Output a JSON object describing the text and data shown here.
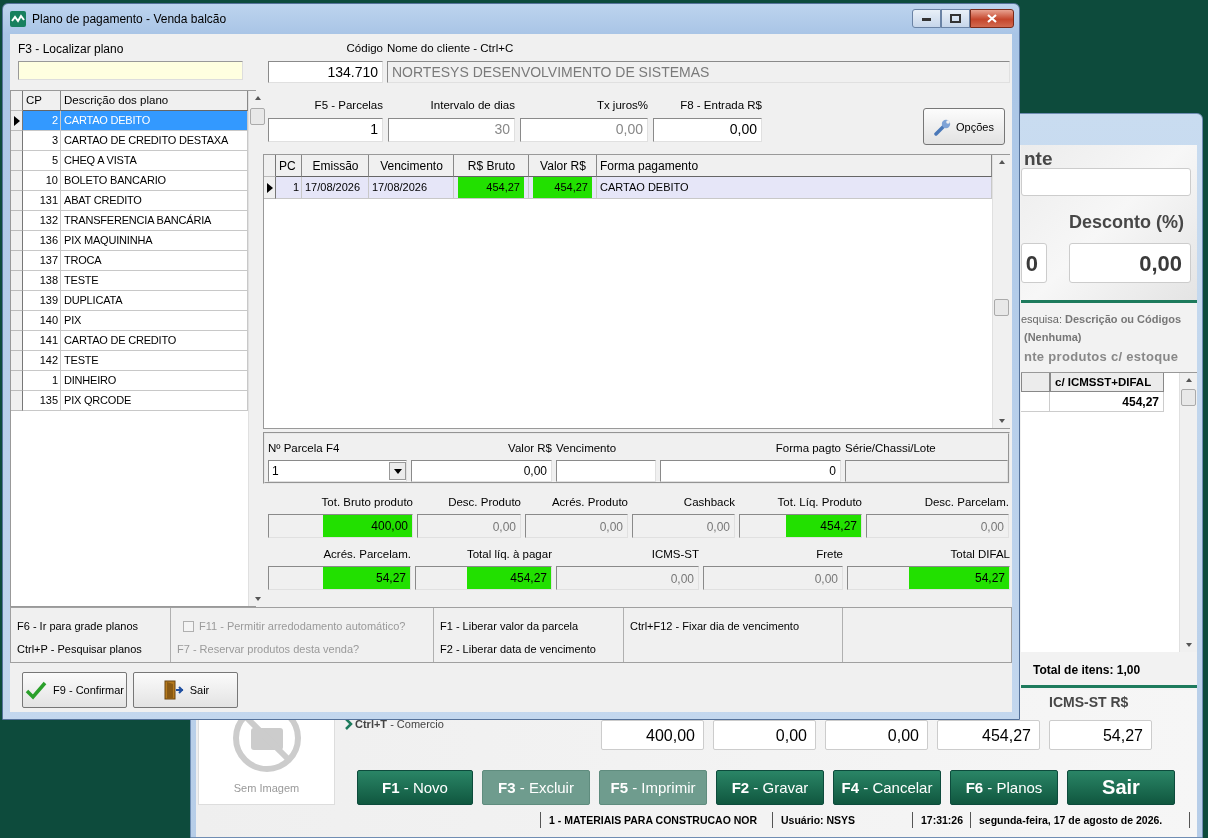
{
  "desktop_window": {
    "right_panel": {
      "heading": "nte",
      "field_value": "0",
      "discount_label": "Desconto (%)",
      "discount_value": "0,00",
      "search_label": "esquisa:",
      "search_value": "Descrição ou Códigos",
      "filter": "(Nenhuma)",
      "stock_filter": "nte produtos c/ estoque",
      "grid_column": "c/ ICMSST+DIFAL",
      "grid_value": "454,27",
      "total_items": "Total de itens: 1,00"
    },
    "no_image_label": "Sem Imagem",
    "shortcut_hint": "**Ctrl+T** - Comercio",
    "totals_label": "ICMS-ST R$",
    "totals": [
      "400,00",
      "0,00",
      "0,00",
      "454,27",
      "54,27"
    ],
    "buttons": [
      {
        "label": "**F1** - Novo",
        "kind": "normal",
        "disabled": false
      },
      {
        "label": "**F3** - Excluir",
        "kind": "normal",
        "disabled": true
      },
      {
        "label": "**F5** - Imprimir",
        "kind": "normal",
        "disabled": true
      },
      {
        "label": "**F2** - Gravar",
        "kind": "normal",
        "disabled": false
      },
      {
        "label": "**F4** - Cancelar",
        "kind": "normal",
        "disabled": false
      },
      {
        "label": "**F6** - Planos",
        "kind": "normal",
        "disabled": false
      },
      {
        "label": "Sair",
        "kind": "exit",
        "disabled": false
      }
    ],
    "status_bar": [
      "1 - MATERIAIS PARA CONSTRUCAO NOR",
      "Usuário: NSYS",
      "17:31:26",
      "segunda-feira, 17 de agosto de 2026."
    ]
  },
  "dialog": {
    "title": "Plano de pagamento - Venda balcão",
    "plan_search": {
      "label": "F3 - Localizar plano"
    },
    "plans": {
      "columns": [
        "CP",
        "Descrição dos plano"
      ],
      "rows": [
        {
          "code": "2",
          "description": "CARTAO DEBITO",
          "selected": true
        },
        {
          "code": "3",
          "description": "CARTAO DE CREDITO DESTAXA",
          "selected": false
        },
        {
          "code": "5",
          "description": "CHEQ A VISTA",
          "selected": false
        },
        {
          "code": "10",
          "description": "BOLETO BANCARIO",
          "selected": false
        },
        {
          "code": "131",
          "description": "ABAT CREDITO",
          "selected": false
        },
        {
          "code": "132",
          "description": "TRANSFERENCIA BANCÁRIA",
          "selected": false
        },
        {
          "code": "136",
          "description": "PIX MAQUININHA",
          "selected": false
        },
        {
          "code": "137",
          "description": "TROCA",
          "selected": false
        },
        {
          "code": "138",
          "description": "TESTE",
          "selected": false
        },
        {
          "code": "139",
          "description": "DUPLICATA",
          "selected": false
        },
        {
          "code": "140",
          "description": "PIX",
          "selected": false
        },
        {
          "code": "141",
          "description": "CARTAO DE CREDITO",
          "selected": false
        },
        {
          "code": "142",
          "description": "TESTE",
          "selected": false
        },
        {
          "code": "1",
          "description": "DINHEIRO",
          "selected": false
        },
        {
          "code": "135",
          "description": "PIX QRCODE",
          "selected": false
        }
      ]
    },
    "header_fields": [
      [
        {
          "label": "Código",
          "value": "134.710",
          "kind": "number",
          "disabled": false
        },
        {
          "label": "Nome do cliente - Ctrl+C",
          "value": "NORTESYS DESENVOLVIMENTO DE SISTEMAS",
          "kind": "text",
          "disabled": true
        }
      ],
      [
        {
          "label": "F5 - Parcelas",
          "value": "1",
          "kind": "number",
          "disabled": false
        },
        {
          "label": "Intervalo de dias",
          "value": "30",
          "kind": "number",
          "disabled": true
        },
        {
          "label": "Tx juros%",
          "value": "0,00",
          "kind": "number",
          "disabled": true
        },
        {
          "label": "F8 - Entrada R$",
          "value": "0,00",
          "kind": "number",
          "disabled": false
        }
      ]
    ],
    "options_button": "Opções",
    "installments": {
      "columns": [
        "PC",
        "Emissão",
        "Vencimento",
        "R$ Bruto",
        "Valor R$",
        "Forma pagamento"
      ],
      "rows": [
        {
          "selected": true,
          "cells": [
            {
              "text": "1",
              "highlighted": false
            },
            {
              "text": "17/08/2026",
              "highlighted": false
            },
            {
              "text": "17/08/2026",
              "highlighted": false
            },
            {
              "text": "454,27",
              "highlighted": true
            },
            {
              "text": "454,27",
              "highlighted": true
            },
            {
              "text": "CARTAO DEBITO",
              "highlighted": false
            }
          ]
        }
      ]
    },
    "installment_editor": [
      {
        "label": "Nº Parcela F4",
        "value": "1",
        "kind": "combo"
      },
      {
        "label": "Valor R$",
        "value": "0,00",
        "kind": "number"
      },
      {
        "label": "Vencimento",
        "kind": "text"
      },
      {
        "label": "Forma pagto",
        "value": "0",
        "kind": "number"
      },
      {
        "label": "Série/Chassi/Lote",
        "kind": "disabled"
      }
    ],
    "totals": [
      [
        {
          "label": "Tot. Bruto produto",
          "value": "400,00",
          "highlighted": true
        },
        {
          "label": "Desc. Produto",
          "value": "0,00",
          "highlighted": false
        },
        {
          "label": "Acrés. Produto",
          "value": "0,00",
          "highlighted": false
        },
        {
          "label": "Cashback",
          "value": "0,00",
          "highlighted": false
        },
        {
          "label": "Tot. Líq. Produto",
          "value": "454,27",
          "highlighted": true
        },
        {
          "label": "Desc. Parcelam.",
          "value": "0,00",
          "highlighted": false
        }
      ],
      [
        {
          "label": "Acrés. Parcelam.",
          "value": "54,27",
          "highlighted": true
        },
        {
          "label": "Total líq. à pagar",
          "value": "454,27",
          "highlighted": true
        },
        {
          "label": "ICMS-ST",
          "value": "0,00",
          "highlighted": false
        },
        {
          "label": "Frete",
          "value": "0,00",
          "highlighted": false
        },
        {
          "label": "Total DIFAL",
          "value": "54,27",
          "highlighted": true
        }
      ]
    ],
    "shortcuts": [
      [
        {
          "text": "F6 - Ir para grade planos",
          "kind": "text",
          "disabled": false
        },
        {
          "text": "Ctrl+P - Pesquisar planos",
          "kind": "text",
          "disabled": false
        }
      ],
      [
        {
          "text": "F11 - Permitir arredodamento automático?",
          "kind": "checkbox",
          "checked": false,
          "disabled": true
        },
        {
          "text": "F7 - Reservar produtos desta venda?",
          "kind": "text",
          "disabled": true
        }
      ],
      [
        {
          "text": "F1 - Liberar valor da parcela",
          "kind": "text",
          "disabled": false
        },
        {
          "text": "F2 - Liberar data de vencimento",
          "kind": "text",
          "disabled": false
        }
      ],
      [
        {
          "text": "Ctrl+F12 - Fixar dia de vencimento",
          "kind": "text",
          "disabled": false
        }
      ]
    ],
    "buttons": [
      {
        "label": "F9 - Confirmar",
        "kind": "confirm"
      },
      {
        "label": "Sair",
        "kind": "exit"
      }
    ]
  }
}
